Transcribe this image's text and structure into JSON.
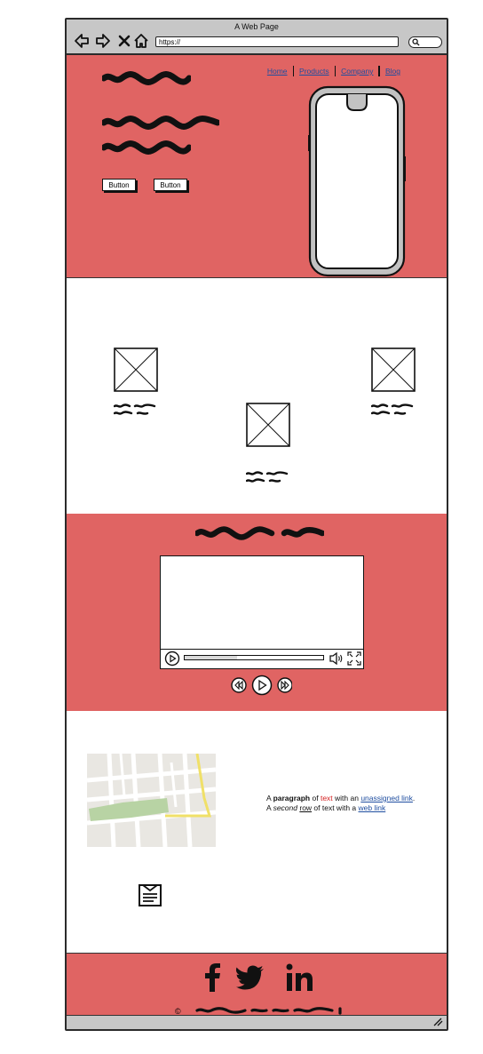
{
  "browser": {
    "title": "A Web Page",
    "url": "https://",
    "icons": [
      "back-icon",
      "forward-icon",
      "close-icon",
      "home-icon",
      "search-icon"
    ]
  },
  "nav": {
    "items": [
      "Home",
      "Products",
      "Company",
      "Blog"
    ]
  },
  "hero": {
    "buttons": [
      "Button",
      "Button"
    ]
  },
  "paragraph": {
    "l1_a": "A ",
    "l1_b": "paragraph",
    "l1_c": " of ",
    "l1_d": "text",
    "l1_e": " with an ",
    "l1_f": "unassigned link",
    "l1_g": ".",
    "l2_a": "A ",
    "l2_b": "second",
    "l2_c": " ",
    "l2_d": "row",
    "l2_e": " of text with a ",
    "l2_f": "web link"
  },
  "footer": {
    "copyright": "©"
  },
  "video": {
    "progress": 0.38
  },
  "colors": {
    "accent": "#e06463",
    "chrome": "#c7c7c7",
    "link": "#1f4ea0",
    "highlight_red": "#d42020"
  }
}
